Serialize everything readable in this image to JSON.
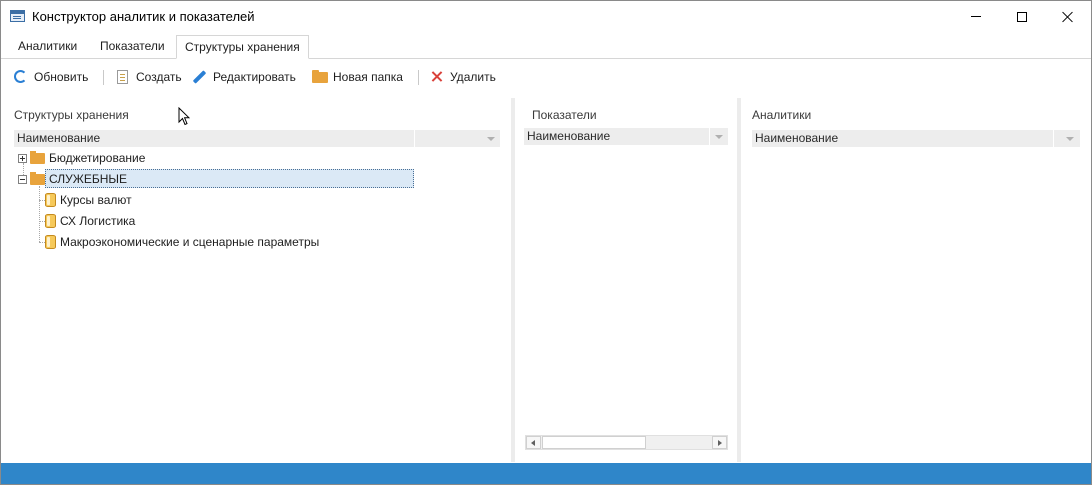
{
  "window": {
    "title": "Конструктор аналитик и показателей",
    "icon": "app-window-icon"
  },
  "tabs": [
    {
      "label": "Аналитики",
      "active": false
    },
    {
      "label": "Показатели",
      "active": false
    },
    {
      "label": "Структуры хранения",
      "active": true
    }
  ],
  "toolbar": {
    "refresh_label": "Обновить",
    "create_label": "Создать",
    "edit_label": "Редактировать",
    "new_folder_label": "Новая папка",
    "delete_label": "Удалить"
  },
  "panels": {
    "storage": {
      "title": "Структуры хранения",
      "column": "Наименование",
      "tree": [
        {
          "label": "Бюджетирование",
          "type": "folder",
          "expanded": false
        },
        {
          "label": "СЛУЖЕБНЫЕ",
          "type": "folder",
          "expanded": true,
          "selected": true,
          "children": [
            {
              "label": "Курсы валют",
              "type": "cube"
            },
            {
              "label": "СХ Логистика",
              "type": "cube"
            },
            {
              "label": "Макроэкономические и сценарные параметры",
              "type": "cube"
            }
          ]
        }
      ]
    },
    "indicators": {
      "title": "Показатели",
      "column": "Наименование"
    },
    "analytics": {
      "title": "Аналитики",
      "column": "Наименование"
    }
  },
  "colors": {
    "accent": "#2f86c9",
    "selection": "#dbe9f6",
    "folder": "#e8a33c",
    "delete": "#d9413a"
  }
}
